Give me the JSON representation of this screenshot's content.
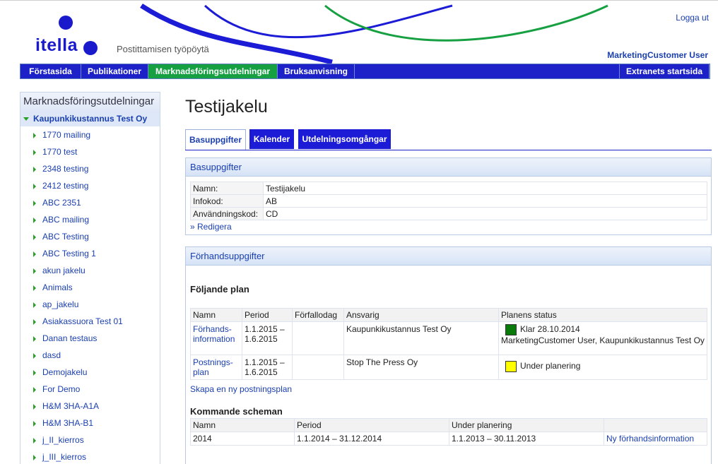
{
  "header": {
    "logo_text": "itella",
    "subtitle": "Postittamisen työpöytä",
    "logout": "Logga ut",
    "user": "MarketingCustomer User"
  },
  "nav": {
    "items": [
      {
        "label": "Förstasida"
      },
      {
        "label": "Publikationer"
      },
      {
        "label": "Marknadsföringsutdelningar",
        "active": true
      },
      {
        "label": "Bruksanvisning"
      },
      {
        "label": "Extranets startsida"
      }
    ]
  },
  "sidebar": {
    "title": "Marknadsföringsutdelningar",
    "root": "Kaupunkikustannus Test Oy",
    "items": [
      "1770 mailing",
      "1770 test",
      "2348 testing",
      "2412 testing",
      "ABC 2351",
      "ABC mailing",
      "ABC Testing",
      "ABC Testing 1",
      "akun jakelu",
      "Animals",
      "ap_jakelu",
      "Asiakassuora Test 01",
      "Danan testaus",
      "dasd",
      "Demojakelu",
      "For Demo",
      "H&M 3HA-A1A",
      "H&M 3HA-B1",
      "j_II_kierros",
      "j_III_kierros"
    ]
  },
  "main": {
    "title": "Testijakelu",
    "tabs": [
      {
        "label": "Basuppgifter",
        "active": true
      },
      {
        "label": "Kalender"
      },
      {
        "label": "Utdelningsomgångar"
      }
    ]
  },
  "basic": {
    "header": "Basuppgifter",
    "rows": [
      {
        "label": "Namn:",
        "value": "Testijakelu"
      },
      {
        "label": "Infokod:",
        "value": "AB"
      },
      {
        "label": "Användningskod:",
        "value": "CD"
      }
    ],
    "edit_link": "» Redigera"
  },
  "preinfo": {
    "header": "Förhandsuppgifter",
    "following_heading": "Följande plan",
    "plan_columns": [
      "Namn",
      "Period",
      "Förfallodag",
      "Ansvarig",
      "Planens status"
    ],
    "plan_rows": [
      {
        "name": "Förhands-information",
        "period": "1.1.2015 – 1.6.2015",
        "due": "",
        "responsible": "Kaupunkikustannus Test Oy",
        "status_line1": "Klar 28.10.2014",
        "status_line2": "MarketingCustomer User, Kaupunkikustannus Test Oy",
        "status_color": "#0a7a0a"
      },
      {
        "name": "Postnings-plan",
        "period": "1.1.2015 – 1.6.2015",
        "due": "",
        "responsible": "Stop The Press Oy",
        "status_line1": "Under planering",
        "status_line2": "",
        "status_color": "#ffff00"
      }
    ],
    "new_plan_link": "Skapa en ny postningsplan",
    "upcoming_heading": "Kommande scheman",
    "upcoming_columns": [
      "Namn",
      "Period",
      "Under planering",
      ""
    ],
    "upcoming_rows": [
      {
        "name": "2014",
        "period": "1.1.2014 – 31.12.2014",
        "planning": "1.1.2013 – 30.11.2013",
        "action": "Ny förhandsinformation"
      }
    ]
  },
  "colors": {
    "nav_blue": "#1c22c8",
    "nav_active_green": "#17a042",
    "link_blue": "#1a3fb0"
  }
}
